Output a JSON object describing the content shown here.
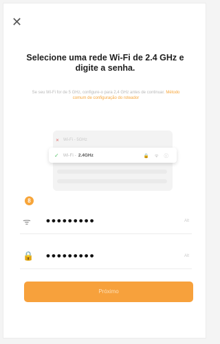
{
  "header": {
    "close_label": "✕"
  },
  "main": {
    "title": "Selecione uma rede Wi-Fi de 2.4 GHz e digite a senha.",
    "subtitle_text": "Se seu Wi-Fi for de 5 GHz, configure-o para 2,4 GHz antes de continuar. ",
    "subtitle_link": "Método comum de configuração do roteador"
  },
  "illustration": {
    "row_top_mark": "✕",
    "row_top_name": "Wi-Fi - 5GHz",
    "row_main_check": "✓",
    "row_main_name": "Wi-Fi -",
    "row_main_band": "2.4GHz",
    "row_main_icons": "🔒 ᯤ ⓘ"
  },
  "badge": {
    "label": "8"
  },
  "form": {
    "wifi_icon": "ᯤ",
    "wifi_value": "•••••••••",
    "wifi_hint": "Alt",
    "lock_icon": "🔒",
    "password_value": "•••••••••",
    "password_hint": "Alt"
  },
  "actions": {
    "next_label": "Próximo"
  },
  "colors": {
    "accent": "#f7a13c",
    "link": "#f6a53a",
    "check": "#58c36a"
  }
}
